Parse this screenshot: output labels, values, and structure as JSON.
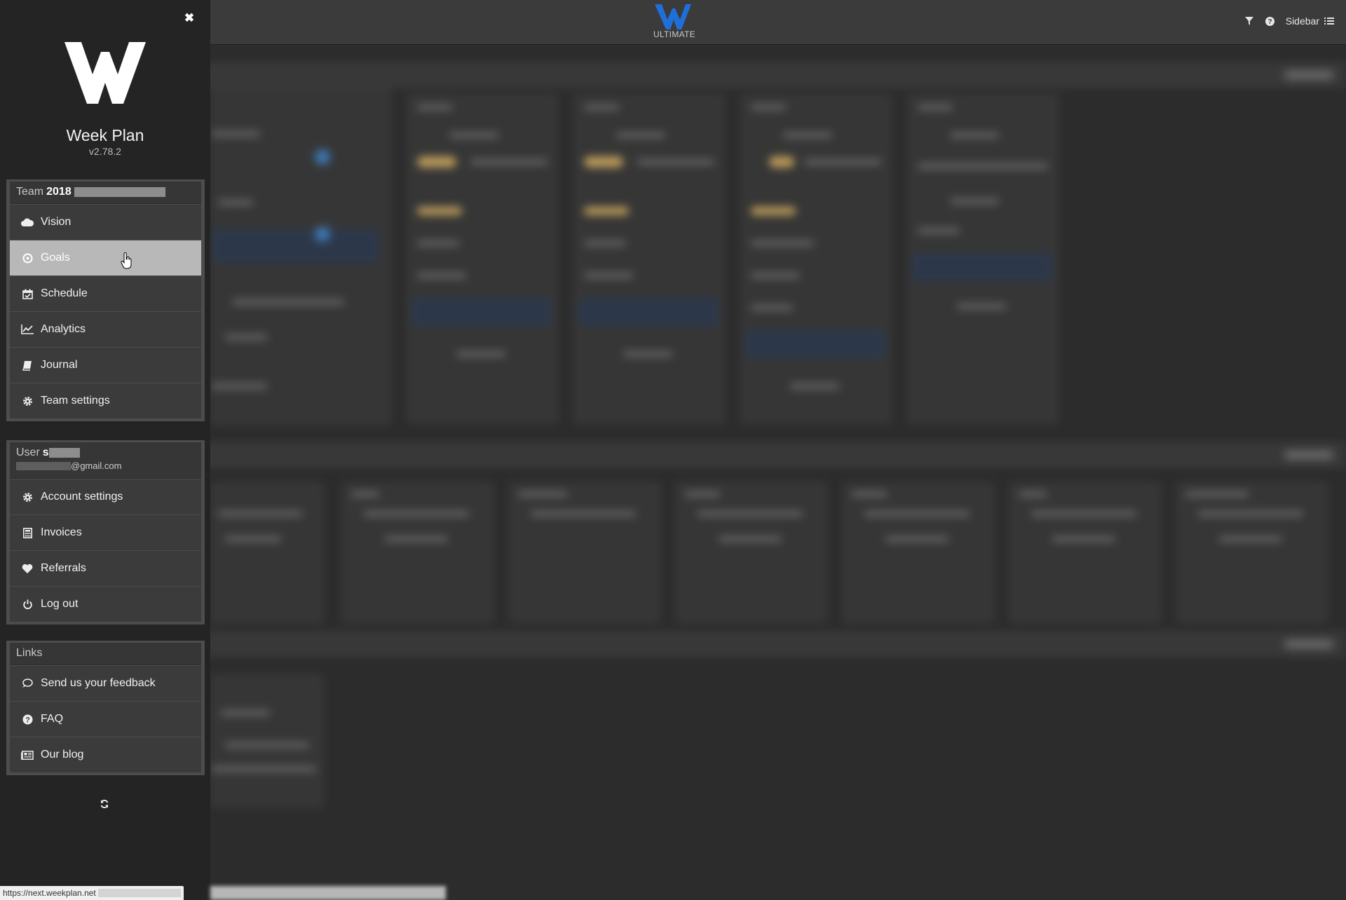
{
  "topbar": {
    "plan_badge": "ULTIMATE",
    "sidebar_label": "Sidebar"
  },
  "app": {
    "name": "Week Plan",
    "version": "v2.78.2"
  },
  "team_panel": {
    "label": "Team",
    "name": "2018",
    "items": [
      {
        "label": "Vision",
        "icon": "cloud-icon"
      },
      {
        "label": "Goals",
        "icon": "target-icon",
        "active": true
      },
      {
        "label": "Schedule",
        "icon": "calendar-check-icon"
      },
      {
        "label": "Analytics",
        "icon": "line-chart-icon"
      },
      {
        "label": "Journal",
        "icon": "book-icon"
      },
      {
        "label": "Team settings",
        "icon": "gear-icon"
      }
    ]
  },
  "user_panel": {
    "label": "User",
    "name_initial": "s",
    "email_domain": "@gmail.com",
    "items": [
      {
        "label": "Account settings",
        "icon": "gear-icon"
      },
      {
        "label": "Invoices",
        "icon": "calculator-icon"
      },
      {
        "label": "Referrals",
        "icon": "heart-icon"
      },
      {
        "label": "Log out",
        "icon": "power-icon"
      }
    ]
  },
  "links_panel": {
    "label": "Links",
    "items": [
      {
        "label": "Send us your feedback",
        "icon": "speech-bubble-icon"
      },
      {
        "label": "FAQ",
        "icon": "question-circle-icon"
      },
      {
        "label": "Our blog",
        "icon": "newspaper-icon"
      }
    ]
  },
  "status_bar": {
    "url": "https://next.weekplan.net"
  },
  "colors": {
    "sidebar_bg": "#242424",
    "item_bg": "#3b3b3b",
    "active_item_bg": "#b8b8b8",
    "brand_blue": "#1e6fd9",
    "highlight_yellow": "#c9a660"
  }
}
